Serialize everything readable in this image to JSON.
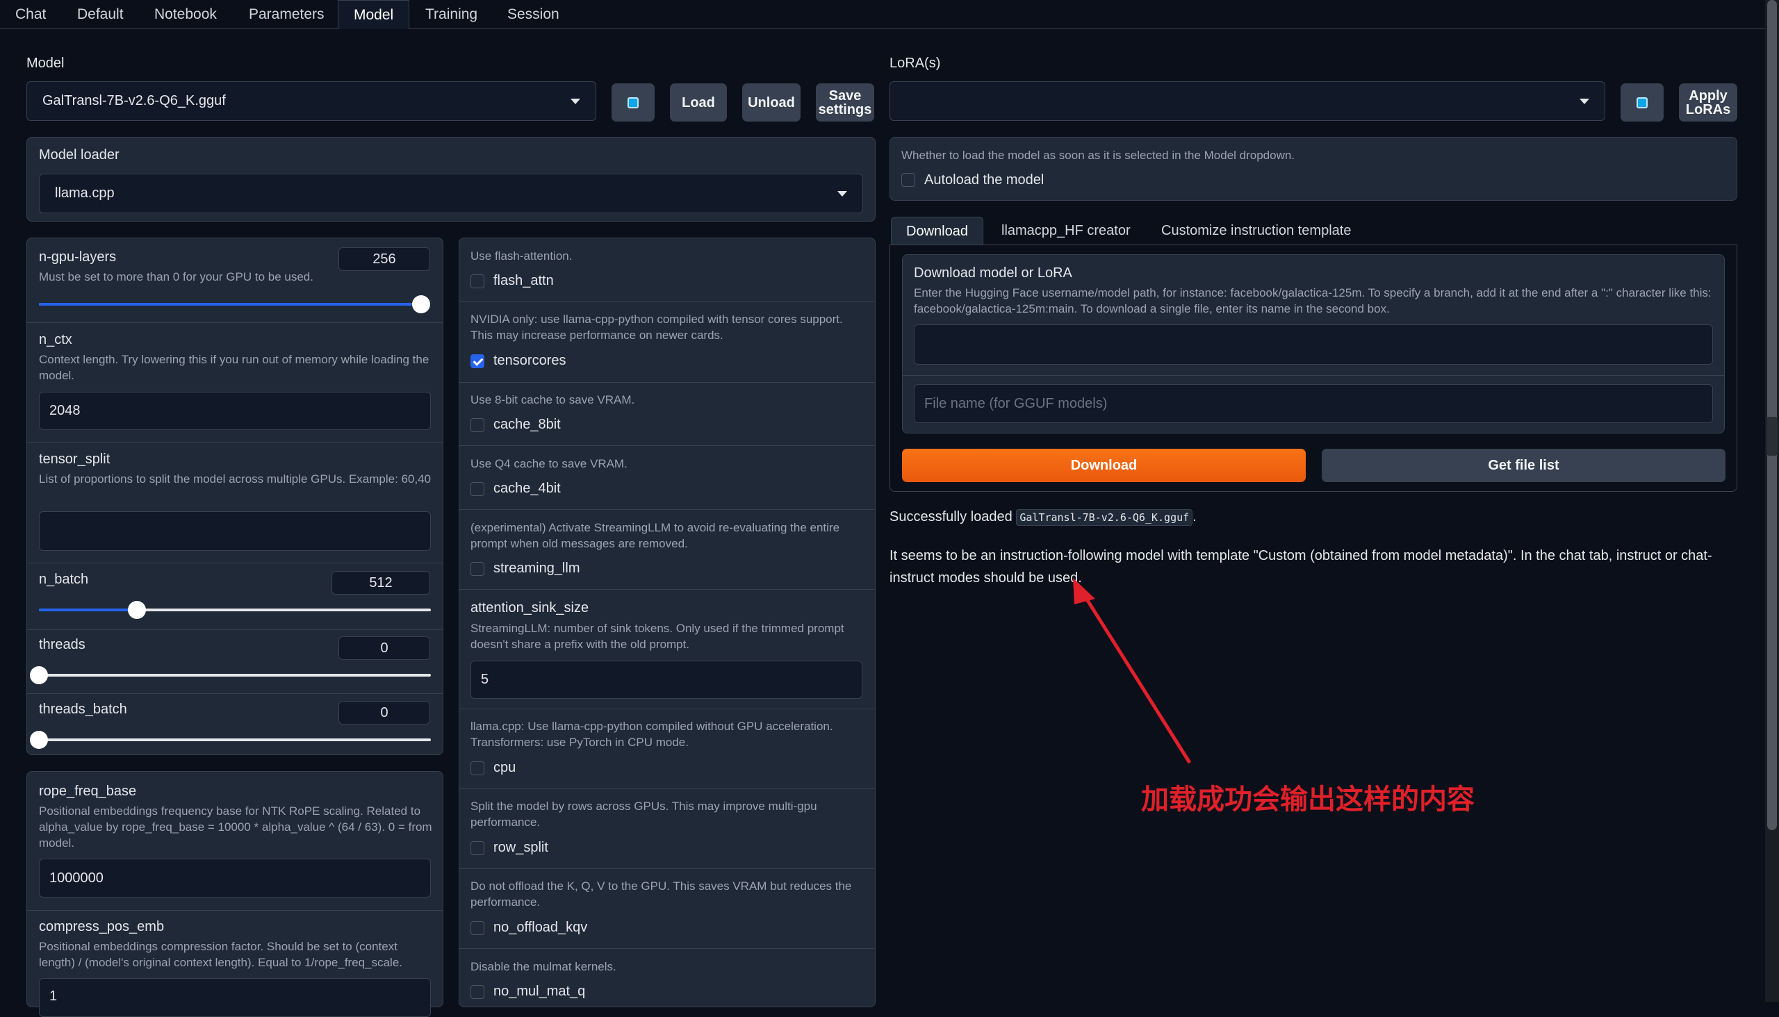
{
  "tabs": [
    "Chat",
    "Default",
    "Notebook",
    "Parameters",
    "Model",
    "Training",
    "Session"
  ],
  "active_tab": "Model",
  "model": {
    "label": "Model",
    "selected": "GalTransl-7B-v2.6-Q6_K.gguf",
    "load_label": "Load",
    "unload_label": "Unload",
    "save_line1": "Save",
    "save_line2": "settings"
  },
  "lora": {
    "label": "LoRA(s)",
    "selected": "",
    "apply_line1": "Apply",
    "apply_line2": "LoRAs"
  },
  "loader": {
    "label": "Model loader",
    "selected": "llama.cpp"
  },
  "params": {
    "n_gpu_layers": {
      "label": "n-gpu-layers",
      "hint": "Must be set to more than 0 for your GPU to be used.",
      "value": "256",
      "fraction": 1.0
    },
    "n_ctx": {
      "label": "n_ctx",
      "hint": "Context length. Try lowering this if you run out of memory while loading the model.",
      "value": "2048"
    },
    "tensor_split": {
      "label": "tensor_split",
      "hint": "List of proportions to split the model across multiple GPUs. Example: 60,40",
      "value": ""
    },
    "n_batch": {
      "label": "n_batch",
      "value": "512",
      "fraction": 0.25
    },
    "threads": {
      "label": "threads",
      "value": "0",
      "fraction": 0.0
    },
    "threads_batch": {
      "label": "threads_batch",
      "value": "0",
      "fraction": 0.0
    },
    "rope_freq_base": {
      "label": "rope_freq_base",
      "hint": "Positional embeddings frequency base for NTK RoPE scaling. Related to alpha_value by rope_freq_base = 10000 * alpha_value ^ (64 / 63). 0 = from model.",
      "value": "1000000"
    },
    "compress_pos_emb": {
      "label": "compress_pos_emb",
      "hint": "Positional embeddings compression factor. Should be set to (context length) / (model's original context length). Equal to 1/rope_freq_scale.",
      "value": "1"
    }
  },
  "flags": {
    "flash_attn": {
      "hint": "Use flash-attention.",
      "label": "flash_attn",
      "checked": false
    },
    "tensorcores": {
      "hint": "NVIDIA only: use llama-cpp-python compiled with tensor cores support. This may increase performance on newer cards.",
      "label": "tensorcores",
      "checked": true
    },
    "cache_8bit": {
      "hint": "Use 8-bit cache to save VRAM.",
      "label": "cache_8bit",
      "checked": false
    },
    "cache_4bit": {
      "hint": "Use Q4 cache to save VRAM.",
      "label": "cache_4bit",
      "checked": false
    },
    "streaming_llm": {
      "hint": "(experimental) Activate StreamingLLM to avoid re-evaluating the entire prompt when old messages are removed.",
      "label": "streaming_llm",
      "checked": false
    },
    "attention_sink_size": {
      "label": "attention_sink_size",
      "hint": "StreamingLLM: number of sink tokens. Only used if the trimmed prompt doesn't share a prefix with the old prompt.",
      "value": "5"
    },
    "cpu": {
      "hint": "llama.cpp: Use llama-cpp-python compiled without GPU acceleration. Transformers: use PyTorch in CPU mode.",
      "label": "cpu",
      "checked": false
    },
    "row_split": {
      "hint": "Split the model by rows across GPUs. This may improve multi-gpu performance.",
      "label": "row_split",
      "checked": false
    },
    "no_offload_kqv": {
      "hint": "Do not offload the K, Q, V to the GPU. This saves VRAM but reduces the performance.",
      "label": "no_offload_kqv",
      "checked": false
    },
    "no_mul_mat_q": {
      "hint": "Disable the mulmat kernels.",
      "label": "no_mul_mat_q",
      "checked": false
    }
  },
  "autoload": {
    "hint": "Whether to load the model as soon as it is selected in the Model dropdown.",
    "label": "Autoload the model",
    "checked": false
  },
  "download_tabs": [
    "Download",
    "llamacpp_HF creator",
    "Customize instruction template"
  ],
  "download": {
    "title": "Download model or LoRA",
    "hint": "Enter the Hugging Face username/model path, for instance: facebook/galactica-125m. To specify a branch, add it at the end after a \":\" character like this: facebook/galactica-125m:main. To download a single file, enter its name in the second box.",
    "repo_value": "",
    "filename_placeholder": "File name (for GGUF models)",
    "download_label": "Download",
    "file_list_label": "Get file list"
  },
  "status": {
    "prefix": "Successfully loaded",
    "model_code": "GalTransl-7B-v2.6-Q6_K.gguf",
    "suffix": ".",
    "message": "It seems to be an instruction-following model with template \"Custom (obtained from model metadata)\". In the chat tab, instruct or chat-instruct modes should be used."
  },
  "annotation": {
    "text": "加载成功会输出这样的内容",
    "color": "#e0202a"
  },
  "colors": {
    "accent": "#f97316",
    "slider": "#2563eb",
    "background": "#0b0f19"
  }
}
